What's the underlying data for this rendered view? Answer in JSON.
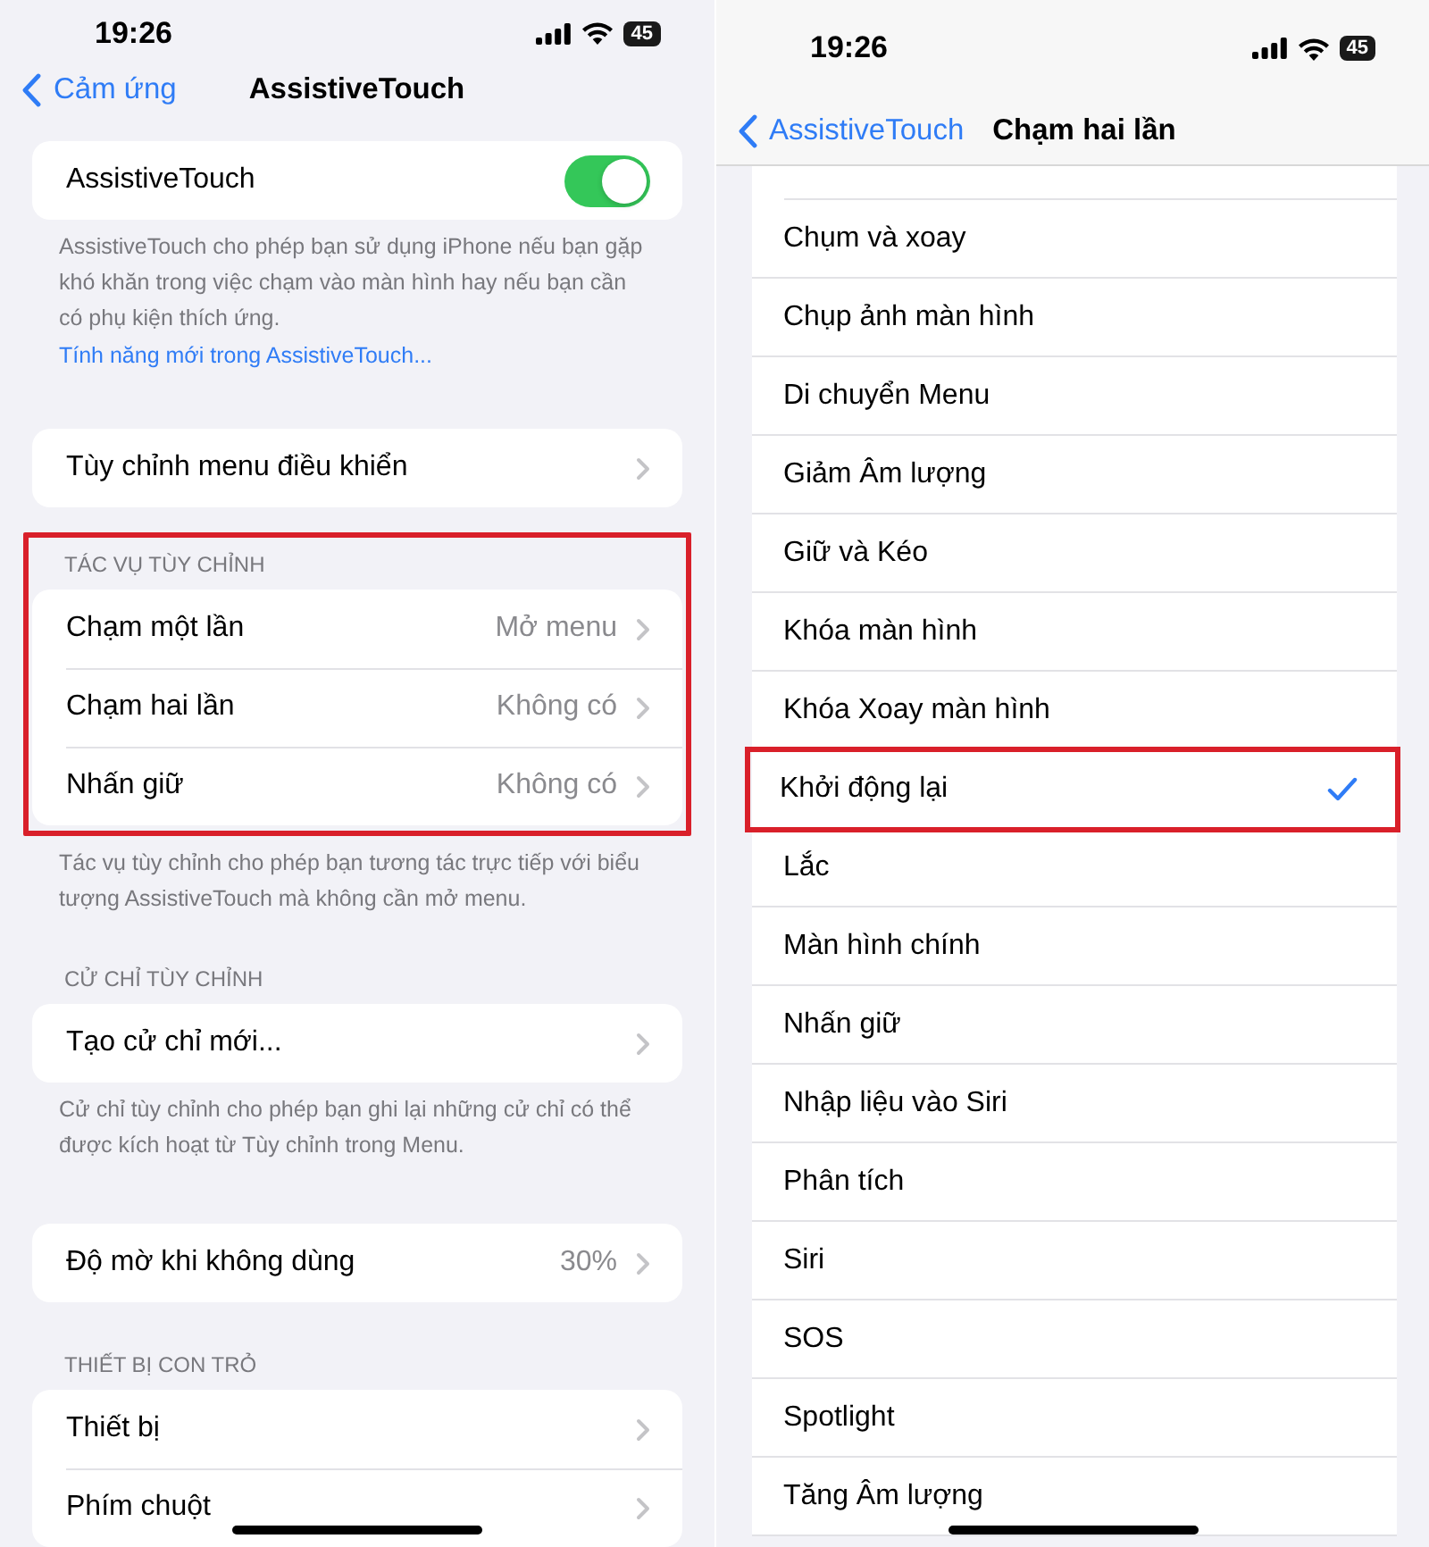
{
  "left_screen": {
    "status_bar": {
      "time": "19:26",
      "battery": "45"
    },
    "nav": {
      "back": "Cảm ứng",
      "title": "AssistiveTouch"
    },
    "groups": [
      {
        "highlighted": false,
        "rows": [
          {
            "kind": "toggle",
            "label": "AssistiveTouch",
            "on": true
          }
        ],
        "footer": "AssistiveTouch cho phép bạn sử dụng iPhone nếu bạn gặp khó khăn trong việc chạm vào màn hình hay nếu bạn cần có phụ kiện thích ứng.",
        "footer_link": "Tính năng mới trong AssistiveTouch..."
      },
      {
        "highlighted": false,
        "rows": [
          {
            "kind": "chevron",
            "label": "Tùy chỉnh menu điều khiển"
          }
        ]
      },
      {
        "highlighted": true,
        "header": "TÁC VỤ TÙY CHỈNH",
        "rows": [
          {
            "kind": "chevron",
            "label": "Chạm một lần",
            "value": "Mở menu"
          },
          {
            "kind": "chevron",
            "label": "Chạm hai lần",
            "value": "Không có"
          },
          {
            "kind": "chevron",
            "label": "Nhấn giữ",
            "value": "Không có"
          }
        ],
        "footer": "Tác vụ tùy chỉnh cho phép bạn tương tác trực tiếp với biểu tượng AssistiveTouch mà không cần mở menu."
      },
      {
        "highlighted": false,
        "header": "CỬ CHỈ TÙY CHỈNH",
        "rows": [
          {
            "kind": "chevron",
            "label": "Tạo cử chỉ mới..."
          }
        ],
        "footer": "Cử chỉ tùy chỉnh cho phép bạn ghi lại những cử chỉ có thể được kích hoạt từ Tùy chỉnh trong Menu."
      },
      {
        "highlighted": false,
        "rows": [
          {
            "kind": "chevron",
            "label": "Độ mờ khi không dùng",
            "value": "30%"
          }
        ]
      },
      {
        "highlighted": false,
        "header": "THIẾT BỊ CON TRỎ",
        "rows": [
          {
            "kind": "chevron",
            "label": "Thiết bị"
          },
          {
            "kind": "chevron",
            "label": "Phím chuột"
          }
        ]
      }
    ]
  },
  "right_screen": {
    "status_bar": {
      "time": "19:26",
      "battery": "45"
    },
    "nav": {
      "back": "AssistiveTouch",
      "title": "Chạm hai lần"
    },
    "options": [
      {
        "label": "Chụm và xoay",
        "selected": false,
        "highlighted": false
      },
      {
        "label": "Chụp ảnh màn hình",
        "selected": false,
        "highlighted": false
      },
      {
        "label": "Di chuyển Menu",
        "selected": false,
        "highlighted": false
      },
      {
        "label": "Giảm Âm lượng",
        "selected": false,
        "highlighted": false
      },
      {
        "label": "Giữ và Kéo",
        "selected": false,
        "highlighted": false
      },
      {
        "label": "Khóa màn hình",
        "selected": false,
        "highlighted": false
      },
      {
        "label": "Khóa Xoay màn hình",
        "selected": false,
        "highlighted": false
      },
      {
        "label": "Khởi động lại",
        "selected": true,
        "highlighted": true
      },
      {
        "label": "Lắc",
        "selected": false,
        "highlighted": false
      },
      {
        "label": "Màn hình chính",
        "selected": false,
        "highlighted": false
      },
      {
        "label": "Nhấn giữ",
        "selected": false,
        "highlighted": false
      },
      {
        "label": "Nhập liệu vào Siri",
        "selected": false,
        "highlighted": false
      },
      {
        "label": "Phân tích",
        "selected": false,
        "highlighted": false
      },
      {
        "label": "Siri",
        "selected": false,
        "highlighted": false
      },
      {
        "label": "SOS",
        "selected": false,
        "highlighted": false
      },
      {
        "label": "Spotlight",
        "selected": false,
        "highlighted": false
      },
      {
        "label": "Tăng Âm lượng",
        "selected": false,
        "highlighted": false
      }
    ]
  }
}
